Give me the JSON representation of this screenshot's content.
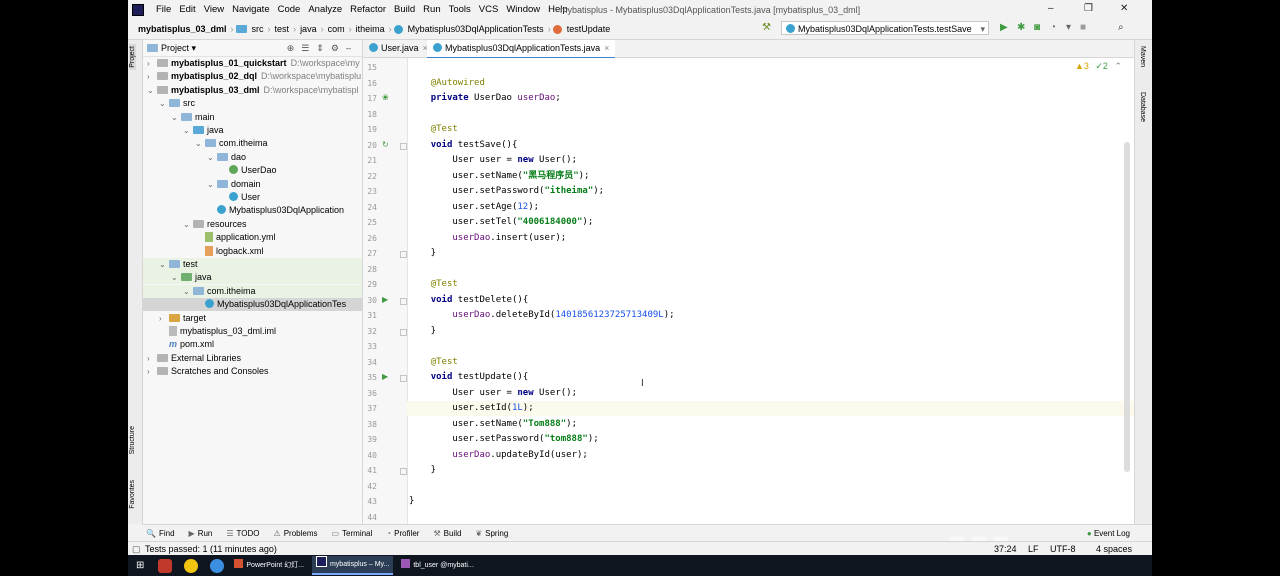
{
  "window": {
    "menu": [
      "File",
      "Edit",
      "View",
      "Navigate",
      "Code",
      "Analyze",
      "Refactor",
      "Build",
      "Run",
      "Tools",
      "VCS",
      "Window",
      "Help"
    ],
    "title": "mybatisplus - Mybatisplus03DqlApplicationTests.java [mybatisplus_03_dml]",
    "controls": {
      "minimize": "–",
      "restore": "❐",
      "close": "✕"
    }
  },
  "breadcrumb": {
    "items": [
      "mybatisplus_03_dml",
      "src",
      "test",
      "java",
      "com",
      "itheima",
      "Mybatisplus03DqlApplicationTests",
      "testUpdate"
    ]
  },
  "toolbar": {
    "run_config": "Mybatisplus03DqlApplicationTests.testSave",
    "hammer_icon": "hammer-icon",
    "run_icon": "run-icon",
    "debug_icon": "debug-icon",
    "coverage_icon": "coverage-icon",
    "profile_icon": "profile-icon",
    "stop_icon": "stop-icon",
    "search_icon": "search-icon"
  },
  "side_labels": {
    "project": "Project",
    "structure": "Structure",
    "favorites": "Favorites",
    "maven": "Maven",
    "database": "Database"
  },
  "project_panel": {
    "header": "Project ▾",
    "tree": [
      {
        "label": "mybatisplus_01_quickstart",
        "path": "D:\\workspace\\my",
        "bold": true
      },
      {
        "label": "mybatisplus_02_dql",
        "path": "D:\\workspace\\mybatisplu",
        "bold": true
      },
      {
        "label": "mybatisplus_03_dml",
        "path": "D:\\workspace\\mybatispl",
        "bold": true
      },
      {
        "label": "src"
      },
      {
        "label": "main"
      },
      {
        "label": "java"
      },
      {
        "label": "com.itheima"
      },
      {
        "label": "dao"
      },
      {
        "label": "UserDao"
      },
      {
        "label": "domain"
      },
      {
        "label": "User"
      },
      {
        "label": "Mybatisplus03DqlApplication"
      },
      {
        "label": "resources"
      },
      {
        "label": "application.yml"
      },
      {
        "label": "logback.xml"
      },
      {
        "label": "test"
      },
      {
        "label": "java"
      },
      {
        "label": "com.itheima"
      },
      {
        "label": "Mybatisplus03DqlApplicationTes"
      },
      {
        "label": "target"
      },
      {
        "label": "mybatisplus_03_dml.iml"
      },
      {
        "label": "pom.xml"
      },
      {
        "label": "External Libraries"
      },
      {
        "label": "Scratches and Consoles"
      }
    ]
  },
  "tabs": [
    {
      "label": "User.java",
      "close": "×"
    },
    {
      "label": "Mybatisplus03DqlApplicationTests.java",
      "close": "×"
    }
  ],
  "editor": {
    "warnings": {
      "warn_count": "▲3",
      "check_count": "✓2"
    },
    "line_numbers": [
      "15",
      "16",
      "17",
      "18",
      "19",
      "20",
      "21",
      "22",
      "23",
      "24",
      "25",
      "26",
      "27",
      "28",
      "29",
      "30",
      "31",
      "32",
      "33",
      "34",
      "35",
      "36",
      "37",
      "38",
      "39",
      "40",
      "41",
      "42",
      "43",
      "44"
    ],
    "lines": [
      {
        "t": ""
      },
      {
        "t": "    @Autowired"
      },
      {
        "t": "    private UserDao userDao;"
      },
      {
        "t": ""
      },
      {
        "t": "    @Test"
      },
      {
        "t": "    void testSave(){"
      },
      {
        "t": "        User user = new User();"
      },
      {
        "t": "        user.setName(\"黑马程序员\");"
      },
      {
        "t": "        user.setPassword(\"itheima\");"
      },
      {
        "t": "        user.setAge(12);"
      },
      {
        "t": "        user.setTel(\"4006184000\");"
      },
      {
        "t": "        userDao.insert(user);"
      },
      {
        "t": "    }"
      },
      {
        "t": ""
      },
      {
        "t": "    @Test"
      },
      {
        "t": "    void testDelete(){"
      },
      {
        "t": "        userDao.deleteById(1401856123725713409L);"
      },
      {
        "t": "    }"
      },
      {
        "t": ""
      },
      {
        "t": "    @Test"
      },
      {
        "t": "    void testUpdate(){"
      },
      {
        "t": "        User user = new User();"
      },
      {
        "t": "        user.setId(1L);"
      },
      {
        "t": "        user.setName(\"Tom888\");"
      },
      {
        "t": "        user.setPassword(\"tom888\");"
      },
      {
        "t": "        userDao.updateById(user);"
      },
      {
        "t": "    }"
      },
      {
        "t": ""
      },
      {
        "t": "}"
      },
      {
        "t": ""
      }
    ]
  },
  "bottom_tools": [
    {
      "g": "🔍",
      "label": "Find"
    },
    {
      "g": "▶",
      "label": "Run"
    },
    {
      "g": "☰",
      "label": "TODO"
    },
    {
      "g": "⚠",
      "label": "Problems"
    },
    {
      "g": "▭",
      "label": "Terminal"
    },
    {
      "g": "◔",
      "label": "Profiler"
    },
    {
      "g": "⚒",
      "label": "Build"
    },
    {
      "g": "❦",
      "label": "Spring"
    }
  ],
  "event_log": "Event Log",
  "status": {
    "message": "Tests passed: 1 (11 minutes ago)",
    "position": "37:24",
    "line_sep": "LF",
    "encoding": "UTF-8",
    "indent": "4 spaces"
  },
  "taskbar": {
    "items": [
      "PowerPoint 幻灯...",
      "mybatisplus – My...",
      "tbl_user @mybati..."
    ]
  }
}
